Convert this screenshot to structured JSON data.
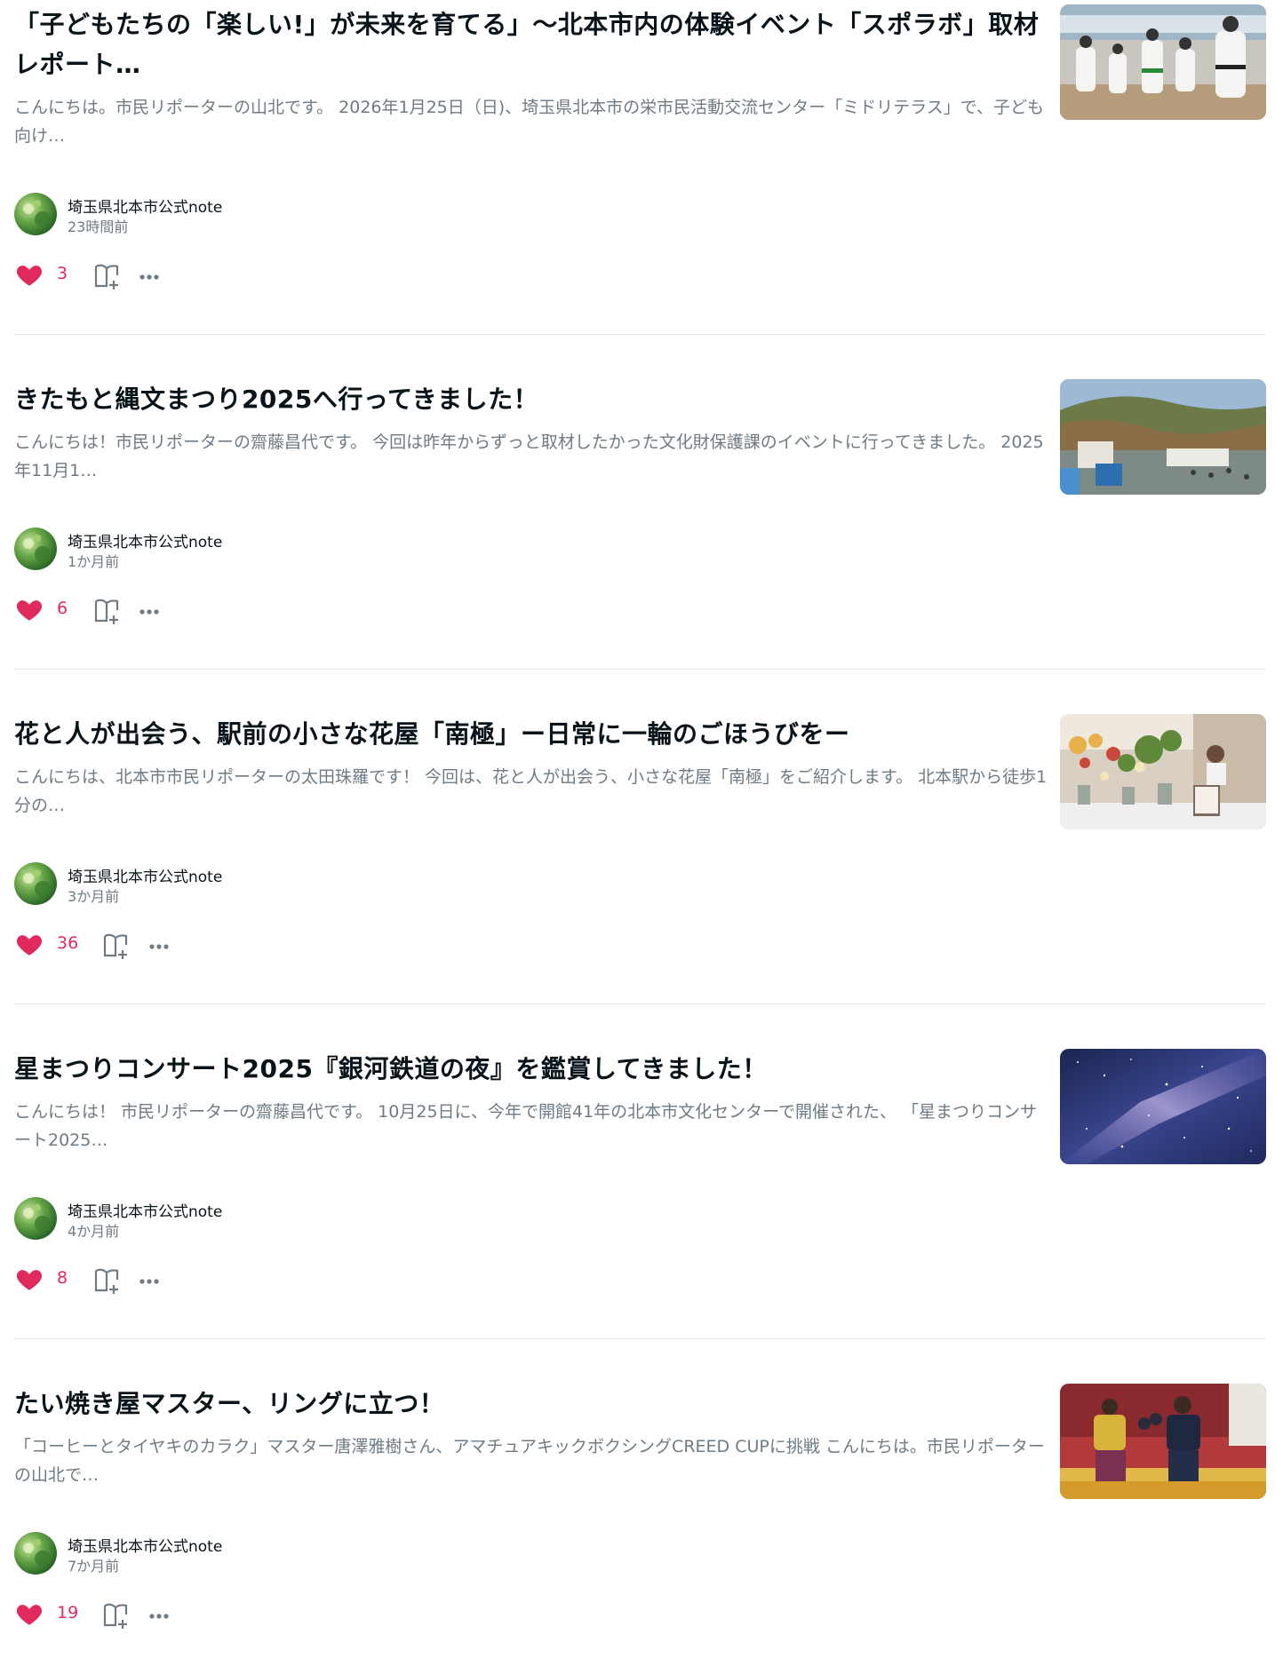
{
  "articles": [
    {
      "title": "「子どもたちの「楽しい!」が未来を育てる」〜北本市内の体験イベント「スポラボ」取材レポート…",
      "excerpt": "こんにちは。市民リポーターの山北です。 2026年1月25日（日)、埼玉県北本市の栄市民活動交流センター「ミドリテラス」で、子ども向け…",
      "author": "埼玉県北本市公式note",
      "time": "23時間前",
      "likes": "3",
      "thumbnail_icon": "karate-class-photo"
    },
    {
      "title": "きたもと縄文まつり2025へ行ってきました！",
      "excerpt": "こんにちは！市民リポーターの齋藤昌代です。 今回は昨年からずっと取材したかった文化財保護課のイベントに行ってきました。 2025年11月1…",
      "author": "埼玉県北本市公式note",
      "time": "1か月前",
      "likes": "6",
      "thumbnail_icon": "festival-park-photo"
    },
    {
      "title": "花と人が出会う、駅前の小さな花屋「南極」ー日常に一輪のごほうびをー",
      "excerpt": "こんにちは、北本市市民リポーターの太田珠羅です！ 今回は、花と人が出会う、小さな花屋「南極」をご紹介します。 北本駅から徒歩1分の…",
      "author": "埼玉県北本市公式note",
      "time": "3か月前",
      "likes": "36",
      "thumbnail_icon": "flower-shop-photo"
    },
    {
      "title": "星まつりコンサート2025『銀河鉄道の夜』を鑑賞してきました！",
      "excerpt": "こんにちは！ 市民リポーターの齋藤昌代です。 10月25日に、今年で開館41年の北本市文化センターで開催された、 「星まつりコンサート2025…",
      "author": "埼玉県北本市公式note",
      "time": "4か月前",
      "likes": "8",
      "thumbnail_icon": "milky-way-photo"
    },
    {
      "title": "たい焼き屋マスター、リングに立つ！",
      "excerpt": "「コーヒーとタイヤキのカラク」マスター唐澤雅樹さん、アマチュアキックボクシングCREED CUPに挑戦 こんにちは。市民リポーターの山北で…",
      "author": "埼玉県北本市公式note",
      "time": "7か月前",
      "likes": "19",
      "thumbnail_icon": "kickboxing-photo"
    }
  ],
  "colors": {
    "like": "#e0295d",
    "text": "#08131a",
    "muted": "#6e7b85",
    "divider": "#e4e7ea"
  }
}
